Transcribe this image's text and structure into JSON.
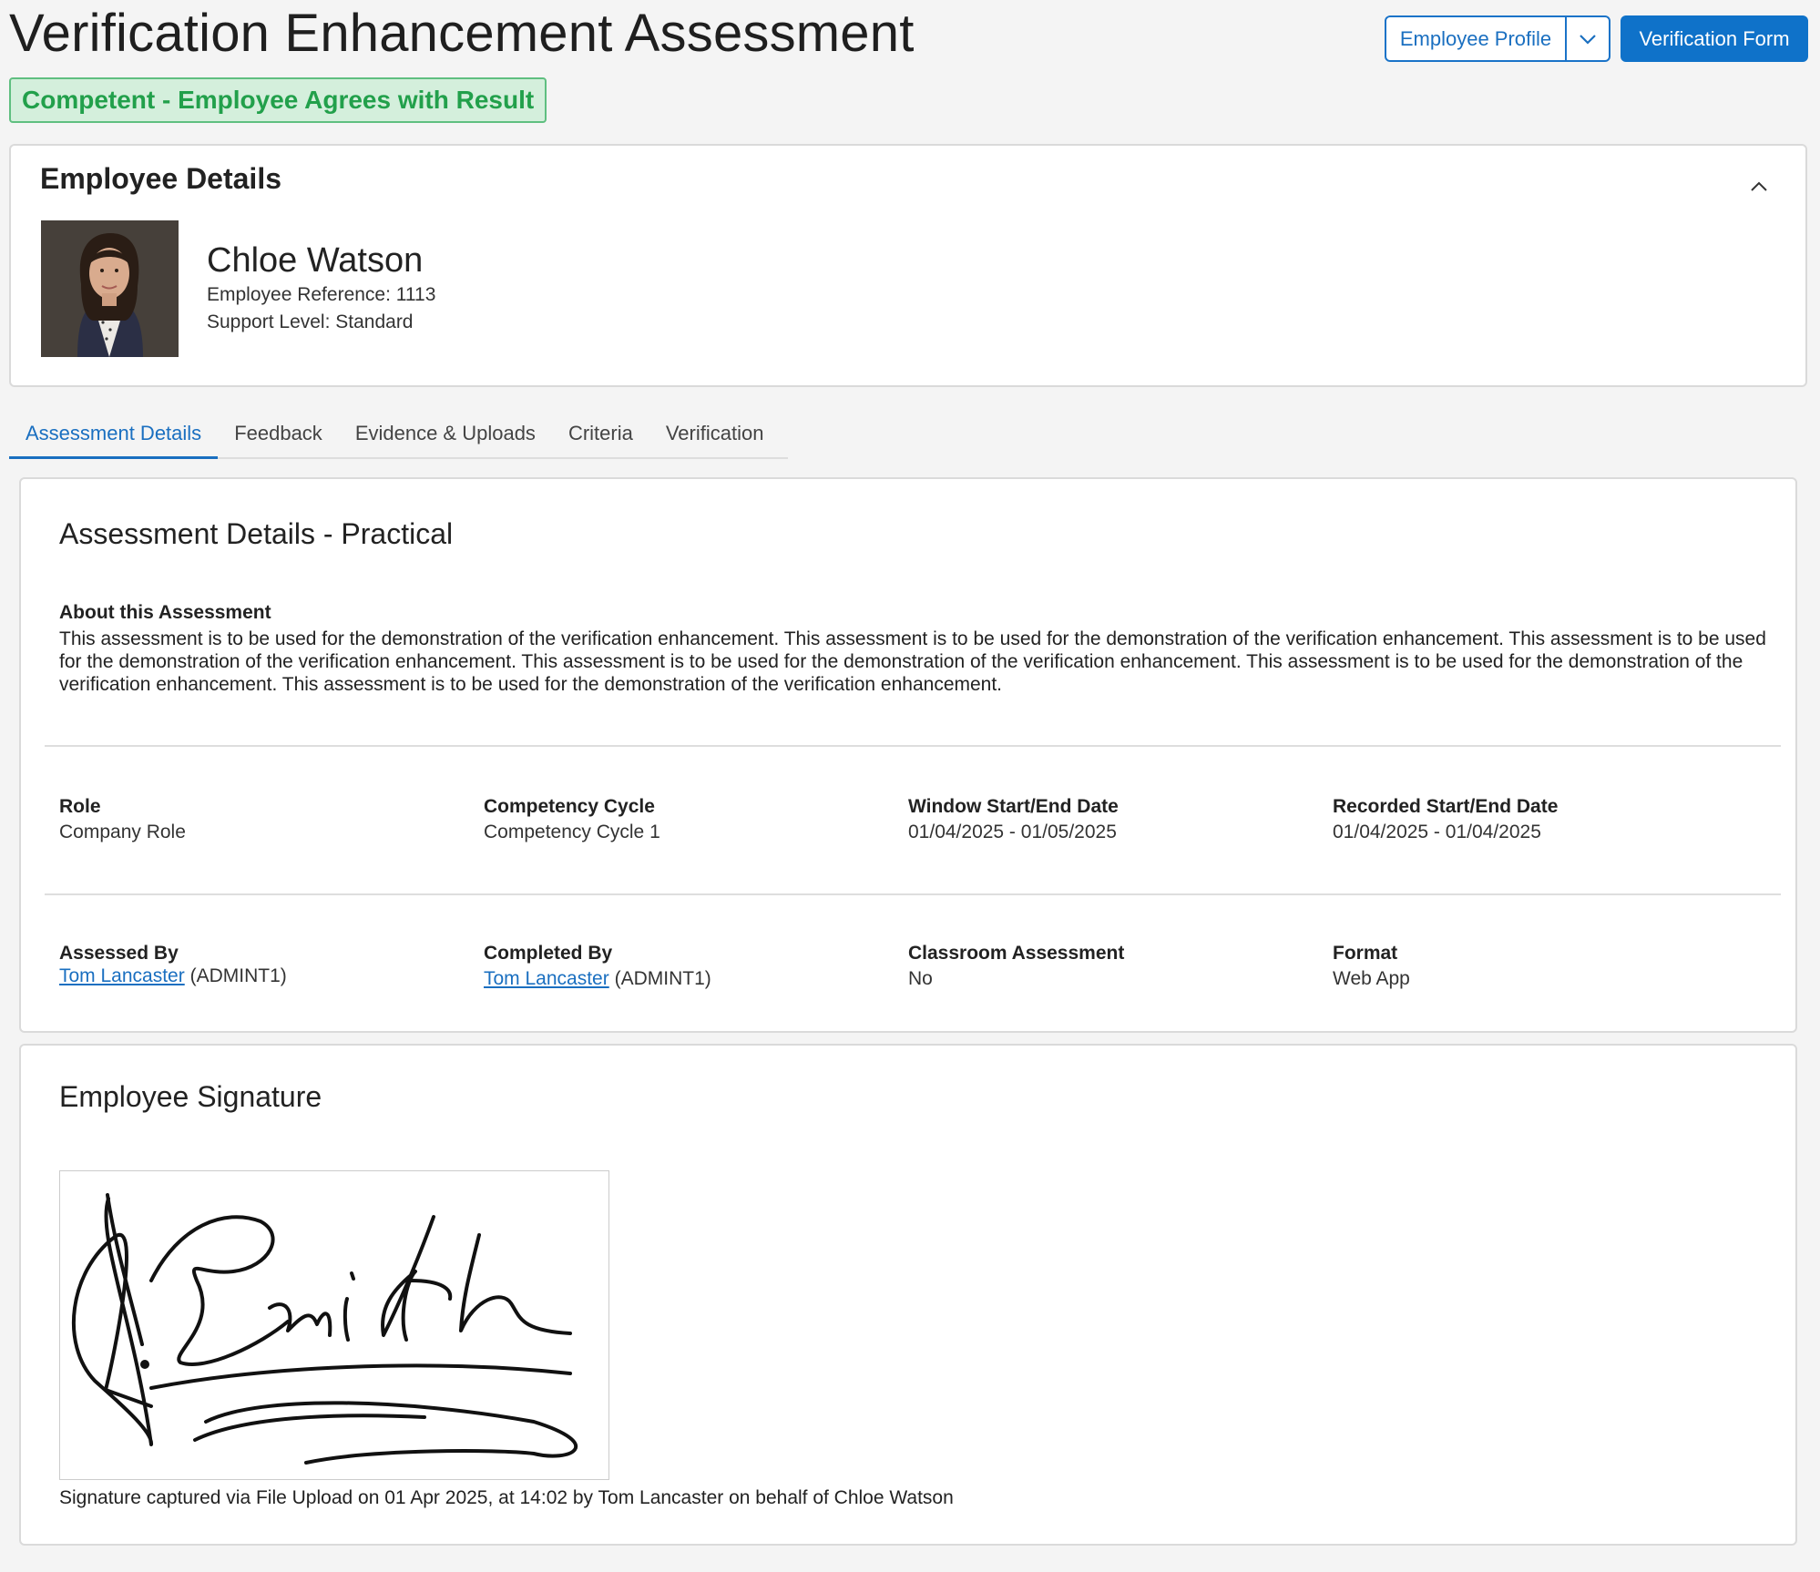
{
  "header": {
    "title": "Verification Enhancement Assessment",
    "status": "Competent - Employee Agrees with Result",
    "profile_button": "Employee Profile",
    "form_button": "Verification Form"
  },
  "employee": {
    "section_title": "Employee Details",
    "name": "Chloe Watson",
    "reference": "Employee Reference: 1113",
    "support_level": "Support Level: Standard"
  },
  "tabs": [
    "Assessment Details",
    "Feedback",
    "Evidence & Uploads",
    "Criteria",
    "Verification"
  ],
  "details": {
    "title": "Assessment Details - Practical",
    "about_label": "About this Assessment",
    "about_text": "This assessment is to be used for the demonstration of the verification enhancement. This assessment is to be used for the demonstration of the verification enhancement. This assessment is to be used for the demonstration of the verification enhancement. This assessment is to be used for the demonstration of the verification enhancement. This assessment is to be used for the demonstration of the verification enhancement. This assessment is to be used for the demonstration of the verification enhancement.",
    "role_label": "Role",
    "role_value": "Company Role",
    "cycle_label": "Competency Cycle",
    "cycle_value": "Competency Cycle 1",
    "window_label": "Window Start/End Date",
    "window_value": "01/04/2025 - 01/05/2025",
    "recorded_label": "Recorded Start/End Date",
    "recorded_value": "01/04/2025 - 01/04/2025",
    "assessed_label": "Assessed By",
    "assessed_name": "Tom Lancaster",
    "assessed_code": "(ADMINT1)",
    "completed_label": "Completed By",
    "completed_name": "Tom Lancaster",
    "completed_code": "(ADMINT1)",
    "classroom_label": "Classroom Assessment",
    "classroom_value": "No",
    "format_label": "Format",
    "format_value": "Web App"
  },
  "signature": {
    "title": "Employee Signature",
    "caption": "Signature captured via File Upload on 01 Apr 2025, at 14:02 by Tom Lancaster on behalf of Chloe Watson"
  },
  "colors": {
    "accent": "#0f72c9",
    "success_bg": "#d4efdc",
    "success_text": "#22a04b"
  }
}
